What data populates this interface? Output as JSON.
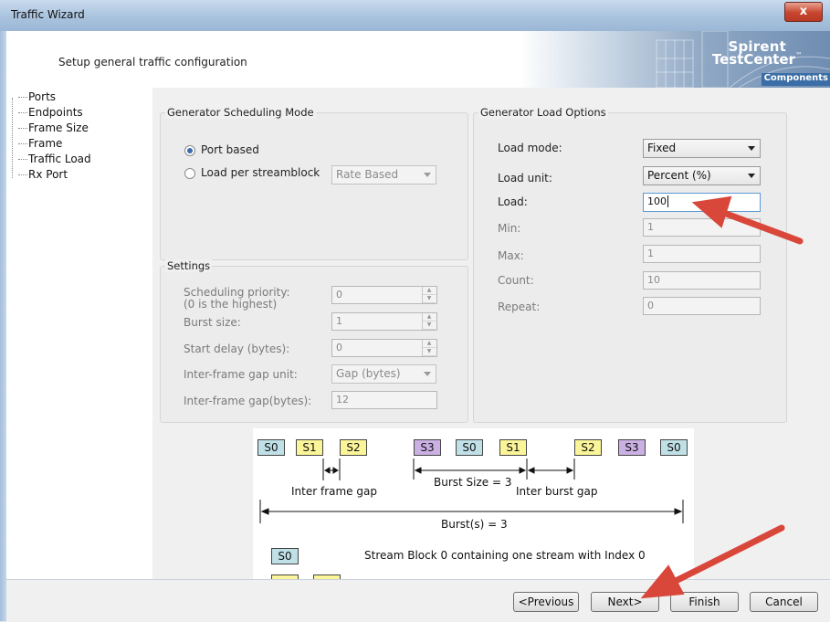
{
  "window": {
    "title": "Traffic Wizard",
    "close_glyph": "x"
  },
  "header": {
    "subtitle": "Setup general traffic configuration",
    "logo_line1": "Spirent",
    "logo_line2": "TestCenter",
    "logo_tm": "™",
    "logo_component": "Components"
  },
  "nav": {
    "items": [
      "Ports",
      "Endpoints",
      "Frame Size",
      "Frame",
      "Traffic Load",
      "Rx Port"
    ]
  },
  "scheduling": {
    "title": "Generator Scheduling Mode",
    "port_based": "Port based",
    "load_per_streamblock": "Load per streamblock",
    "streamblock_mode": "Rate Based",
    "selected": "Port based"
  },
  "settings": {
    "title": "Settings",
    "scheduling_priority_label": "Scheduling priority:",
    "scheduling_priority_hint": "(0 is the highest)",
    "scheduling_priority": "0",
    "burst_size_label": "Burst size:",
    "burst_size": "1",
    "start_delay_label": "Start delay (bytes):",
    "start_delay": "0",
    "ifg_unit_label": "Inter-frame gap unit:",
    "ifg_unit": "Gap (bytes)",
    "ifg_label": "Inter-frame gap(bytes):",
    "ifg": "12"
  },
  "load_options": {
    "title": "Generator Load Options",
    "load_mode_label": "Load mode:",
    "load_mode": "Fixed",
    "load_unit_label": "Load unit:",
    "load_unit": "Percent (%)",
    "load_label": "Load:",
    "load": "100",
    "min_label": "Min:",
    "min": "1",
    "max_label": "Max:",
    "max": "1",
    "count_label": "Count:",
    "count": "10",
    "repeat_label": "Repeat:",
    "repeat": "0"
  },
  "diagram": {
    "row1": [
      "S0",
      "S1",
      "S2",
      "S3",
      "S0",
      "S1",
      "S2",
      "S3",
      "S0"
    ],
    "inter_frame_gap": "Inter frame gap",
    "burst_size": "Burst Size = 3",
    "inter_burst_gap": "Inter burst gap",
    "bursts": "Burst(s) = 3",
    "legend_block": "S0",
    "legend_text": "Stream Block 0 containing one stream with Index 0"
  },
  "footer": {
    "previous": "<Previous",
    "next": "Next>",
    "finish": "Finish",
    "cancel": "Cancel"
  },
  "colors": {
    "arrow": "#d9463a",
    "s0": "#bfe0e6",
    "s1": "#fbf59a",
    "s3": "#cbb0e4"
  }
}
